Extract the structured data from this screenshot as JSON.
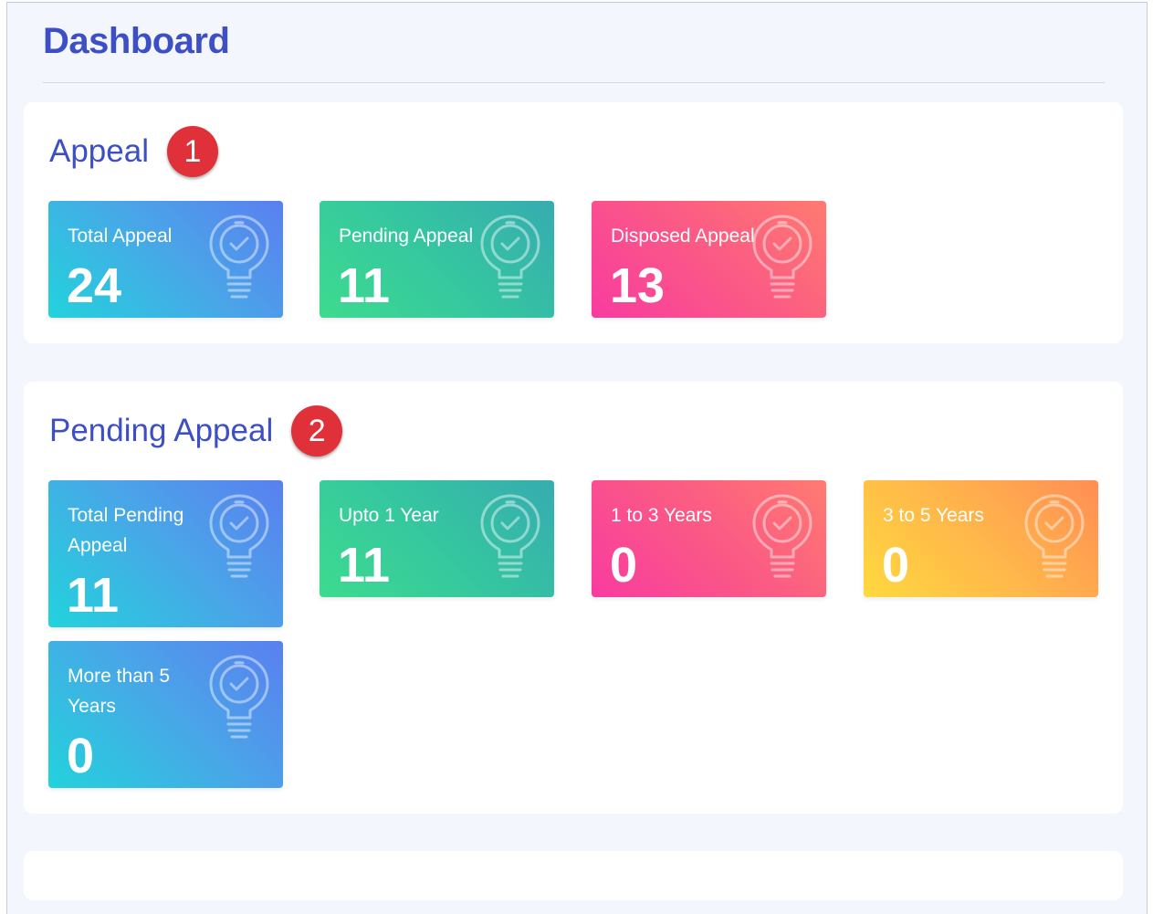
{
  "page": {
    "title": "Dashboard"
  },
  "appeal_section": {
    "title": "Appeal",
    "badge": "1",
    "cards": [
      {
        "label": "Total Appeal",
        "value": "24",
        "color": "blue"
      },
      {
        "label": "Pending Appeal",
        "value": "11",
        "color": "green"
      },
      {
        "label": "Disposed Appeal",
        "value": "13",
        "color": "pink"
      }
    ]
  },
  "pending_section": {
    "title": "Pending Appeal",
    "badge": "2",
    "cards": [
      {
        "label": "Total Pending Appeal",
        "value": "11",
        "color": "blue"
      },
      {
        "label": "Upto 1 Year",
        "value": "11",
        "color": "green"
      },
      {
        "label": "1 to 3 Years",
        "value": "0",
        "color": "pink"
      },
      {
        "label": "3 to 5 Years",
        "value": "0",
        "color": "orange"
      },
      {
        "label": "More than 5 Years",
        "value": "0",
        "color": "blue"
      }
    ]
  },
  "icons": {
    "card_icon": "lightbulb-check-icon"
  },
  "colors": {
    "title": "#3d4fc4",
    "badge": "#e0313a",
    "blue_gradient": [
      "#22d3dc",
      "#5a7ff0"
    ],
    "green_gradient": [
      "#3ddb8e",
      "#36acb0"
    ],
    "pink_gradient": [
      "#f83ba0",
      "#ff7b70"
    ],
    "orange_gradient": [
      "#ffd93e",
      "#ff8e55"
    ]
  }
}
